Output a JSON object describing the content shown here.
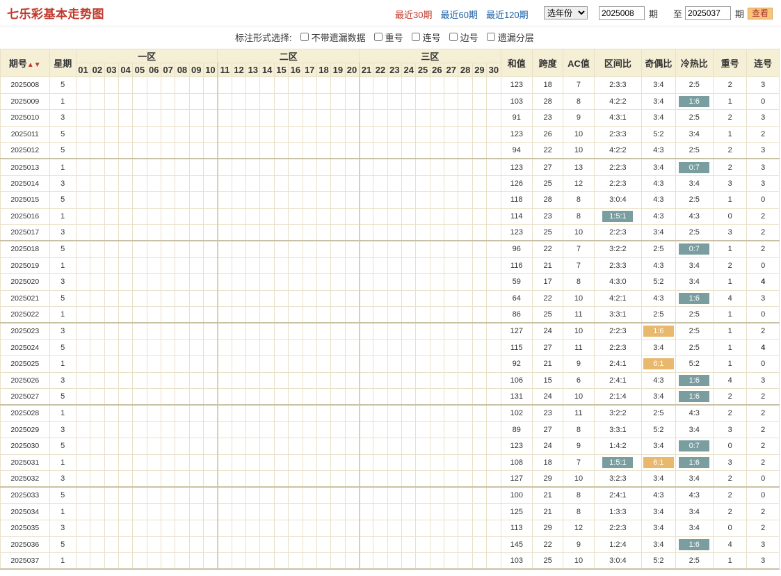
{
  "header": {
    "title": "七乐彩基本走势图",
    "periods": [
      "最近30期",
      "最近60期",
      "最近120期"
    ],
    "active_period": 0,
    "year_select": "选年份",
    "from_value": "2025008",
    "from_label": "期",
    "to_label": "至",
    "to_value": "2025037",
    "to_suffix": "期",
    "view_button": "查看"
  },
  "options": {
    "label": "标注形式选择:",
    "items": [
      "不带遗漏数据",
      "重号",
      "连号",
      "边号",
      "遗漏分层"
    ]
  },
  "table": {
    "col_issue": "期号",
    "col_week": "星期",
    "zones": [
      "一区",
      "二区",
      "三区"
    ],
    "numbers": [
      "01",
      "02",
      "03",
      "04",
      "05",
      "06",
      "07",
      "08",
      "09",
      "10",
      "11",
      "12",
      "13",
      "14",
      "15",
      "16",
      "17",
      "18",
      "19",
      "20",
      "21",
      "22",
      "23",
      "24",
      "25",
      "26",
      "27",
      "28",
      "29",
      "30"
    ],
    "stat_cols": [
      "和值",
      "跨度",
      "AC值",
      "区间比",
      "奇偶比",
      "冷热比",
      "重号",
      "连号"
    ],
    "rows": [
      {
        "issue": "2025008",
        "week": "5",
        "sum": "123",
        "span": "18",
        "ac": "7",
        "zone": "2:3:3",
        "oe": "3:4",
        "ch": "2:5",
        "rep": "2",
        "con": "3"
      },
      {
        "issue": "2025009",
        "week": "1",
        "sum": "103",
        "span": "28",
        "ac": "8",
        "zone": "4:2:2",
        "oe": "3:4",
        "ch": "1:6",
        "rep": "1",
        "con": "0"
      },
      {
        "issue": "2025010",
        "week": "3",
        "sum": "91",
        "span": "23",
        "ac": "9",
        "zone": "4:3:1",
        "oe": "3:4",
        "ch": "2:5",
        "rep": "2",
        "con": "3"
      },
      {
        "issue": "2025011",
        "week": "5",
        "sum": "123",
        "span": "26",
        "ac": "10",
        "zone": "2:3:3",
        "oe": "5:2",
        "ch": "3:4",
        "rep": "1",
        "con": "2"
      },
      {
        "issue": "2025012",
        "week": "5",
        "sum": "94",
        "span": "22",
        "ac": "10",
        "zone": "4:2:2",
        "oe": "4:3",
        "ch": "2:5",
        "rep": "2",
        "con": "3"
      },
      {
        "issue": "2025013",
        "week": "1",
        "sum": "123",
        "span": "27",
        "ac": "13",
        "zone": "2:2:3",
        "oe": "3:4",
        "ch": "0:7",
        "rep": "2",
        "con": "3"
      },
      {
        "issue": "2025014",
        "week": "3",
        "sum": "126",
        "span": "25",
        "ac": "12",
        "zone": "2:2:3",
        "oe": "4:3",
        "ch": "3:4",
        "rep": "3",
        "con": "3"
      },
      {
        "issue": "2025015",
        "week": "5",
        "sum": "118",
        "span": "28",
        "ac": "8",
        "zone": "3:0:4",
        "oe": "4:3",
        "ch": "2:5",
        "rep": "1",
        "con": "0"
      },
      {
        "issue": "2025016",
        "week": "1",
        "sum": "114",
        "span": "23",
        "ac": "8",
        "zone": "1:5:1",
        "oe": "4:3",
        "ch": "4:3",
        "rep": "0",
        "con": "2"
      },
      {
        "issue": "2025017",
        "week": "3",
        "sum": "123",
        "span": "25",
        "ac": "10",
        "zone": "2:2:3",
        "oe": "3:4",
        "ch": "2:5",
        "rep": "3",
        "con": "2"
      },
      {
        "issue": "2025018",
        "week": "5",
        "sum": "96",
        "span": "22",
        "ac": "7",
        "zone": "3:2:2",
        "oe": "2:5",
        "ch": "0:7",
        "rep": "1",
        "con": "2"
      },
      {
        "issue": "2025019",
        "week": "1",
        "sum": "116",
        "span": "21",
        "ac": "7",
        "zone": "2:3:3",
        "oe": "4:3",
        "ch": "3:4",
        "rep": "2",
        "con": "0"
      },
      {
        "issue": "2025020",
        "week": "3",
        "sum": "59",
        "span": "17",
        "ac": "8",
        "zone": "4:3:0",
        "oe": "5:2",
        "ch": "3:4",
        "rep": "1",
        "con": "4"
      },
      {
        "issue": "2025021",
        "week": "5",
        "sum": "64",
        "span": "22",
        "ac": "10",
        "zone": "4:2:1",
        "oe": "4:3",
        "ch": "1:6",
        "rep": "4",
        "con": "3"
      },
      {
        "issue": "2025022",
        "week": "1",
        "sum": "86",
        "span": "25",
        "ac": "11",
        "zone": "3:3:1",
        "oe": "2:5",
        "ch": "2:5",
        "rep": "1",
        "con": "0"
      },
      {
        "issue": "2025023",
        "week": "3",
        "sum": "127",
        "span": "24",
        "ac": "10",
        "zone": "2:2:3",
        "oe": "1:6",
        "ch": "2:5",
        "rep": "1",
        "con": "2"
      },
      {
        "issue": "2025024",
        "week": "5",
        "sum": "115",
        "span": "27",
        "ac": "11",
        "zone": "2:2:3",
        "oe": "3:4",
        "ch": "2:5",
        "rep": "1",
        "con": "4"
      },
      {
        "issue": "2025025",
        "week": "1",
        "sum": "92",
        "span": "21",
        "ac": "9",
        "zone": "2:4:1",
        "oe": "6:1",
        "ch": "5:2",
        "rep": "1",
        "con": "0"
      },
      {
        "issue": "2025026",
        "week": "3",
        "sum": "106",
        "span": "15",
        "ac": "6",
        "zone": "2:4:1",
        "oe": "4:3",
        "ch": "1:6",
        "rep": "4",
        "con": "3"
      },
      {
        "issue": "2025027",
        "week": "5",
        "sum": "131",
        "span": "24",
        "ac": "10",
        "zone": "2:1:4",
        "oe": "3:4",
        "ch": "1:6",
        "rep": "2",
        "con": "2"
      },
      {
        "issue": "2025028",
        "week": "1",
        "sum": "102",
        "span": "23",
        "ac": "11",
        "zone": "3:2:2",
        "oe": "2:5",
        "ch": "4:3",
        "rep": "2",
        "con": "2"
      },
      {
        "issue": "2025029",
        "week": "3",
        "sum": "89",
        "span": "27",
        "ac": "8",
        "zone": "3:3:1",
        "oe": "5:2",
        "ch": "3:4",
        "rep": "3",
        "con": "2"
      },
      {
        "issue": "2025030",
        "week": "5",
        "sum": "123",
        "span": "24",
        "ac": "9",
        "zone": "1:4:2",
        "oe": "3:4",
        "ch": "0:7",
        "rep": "0",
        "con": "2"
      },
      {
        "issue": "2025031",
        "week": "1",
        "sum": "108",
        "span": "18",
        "ac": "7",
        "zone": "1:5:1",
        "oe": "6:1",
        "ch": "1:6",
        "rep": "3",
        "con": "2"
      },
      {
        "issue": "2025032",
        "week": "3",
        "sum": "127",
        "span": "29",
        "ac": "10",
        "zone": "3:2:3",
        "oe": "3:4",
        "ch": "3:4",
        "rep": "2",
        "con": "0"
      },
      {
        "issue": "2025033",
        "week": "5",
        "sum": "100",
        "span": "21",
        "ac": "8",
        "zone": "2:4:1",
        "oe": "4:3",
        "ch": "4:3",
        "rep": "2",
        "con": "0"
      },
      {
        "issue": "2025034",
        "week": "1",
        "sum": "125",
        "span": "21",
        "ac": "8",
        "zone": "1:3:3",
        "oe": "3:4",
        "ch": "3:4",
        "rep": "2",
        "con": "2"
      },
      {
        "issue": "2025035",
        "week": "3",
        "sum": "113",
        "span": "29",
        "ac": "12",
        "zone": "2:2:3",
        "oe": "3:4",
        "ch": "3:4",
        "rep": "0",
        "con": "2"
      },
      {
        "issue": "2025036",
        "week": "5",
        "sum": "145",
        "span": "22",
        "ac": "9",
        "zone": "1:2:4",
        "oe": "3:4",
        "ch": "1:6",
        "rep": "4",
        "con": "3"
      },
      {
        "issue": "2025037",
        "week": "1",
        "sum": "103",
        "span": "25",
        "ac": "10",
        "zone": "3:0:4",
        "oe": "5:2",
        "ch": "2:5",
        "rep": "1",
        "con": "3"
      }
    ]
  },
  "highlights": {
    "ch": [
      1,
      5,
      10,
      13,
      18,
      19,
      22,
      23,
      28
    ],
    "zone": [
      8,
      23
    ],
    "oe": [
      15,
      17,
      23
    ]
  },
  "red_rep": [
    13,
    18,
    28
  ],
  "green_con": [
    12,
    16
  ],
  "colors": {
    "ball_red": "#c0161b",
    "ball_blue": "#2a6cb0",
    "header_bg": "#f5efd6",
    "hl_teal": "#7a9e9f",
    "hl_orange": "#e8b86d"
  }
}
